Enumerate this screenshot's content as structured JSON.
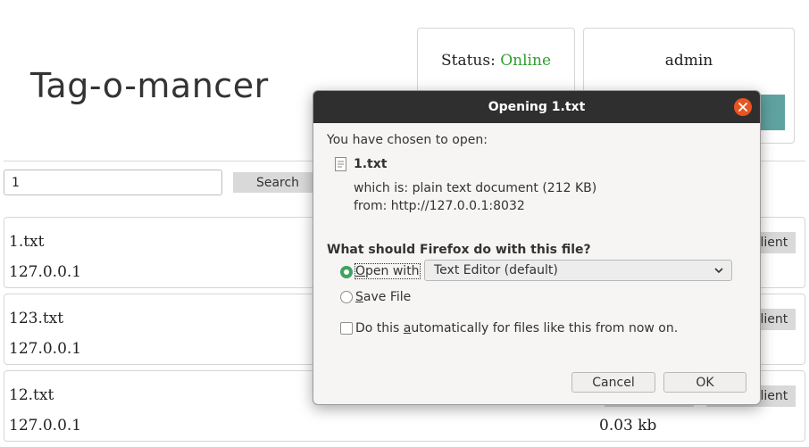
{
  "app": {
    "title": "Tag-o-mancer"
  },
  "status": {
    "label": "Status:",
    "value": "Online"
  },
  "user": {
    "name": "admin"
  },
  "search": {
    "value": "1",
    "button": "Search"
  },
  "files": [
    {
      "name": "1.txt",
      "ip": "127.0.0.1",
      "client_label": "client",
      "size": ""
    },
    {
      "name": "123.txt",
      "ip": "127.0.0.1",
      "client_label": "client",
      "size": ""
    },
    {
      "name": "12.txt",
      "ip": "127.0.0.1",
      "client_label": "client",
      "size": "0.03 kb"
    }
  ],
  "dialog": {
    "title": "Opening 1.txt",
    "chosen_text": "You have chosen to open:",
    "file_name": "1.txt",
    "which_is_label": "which is:",
    "which_is_value": "plain text document (212 KB)",
    "from_label": "from:",
    "from_value": "http://127.0.0.1:8032",
    "question": "What should Firefox do with this file?",
    "open_with_O": "O",
    "open_with_rest": "pen with",
    "open_with_app": "Text Editor (default)",
    "save_S": "S",
    "save_rest": "ave File",
    "auto_pre": "Do this ",
    "auto_a": "a",
    "auto_post": "utomatically for files like this from now on.",
    "cancel": "Cancel",
    "ok": "OK"
  },
  "colors": {
    "online": "#2e9f2e",
    "accent_close": "#e95420",
    "radio_checked": "#3fa35e"
  }
}
